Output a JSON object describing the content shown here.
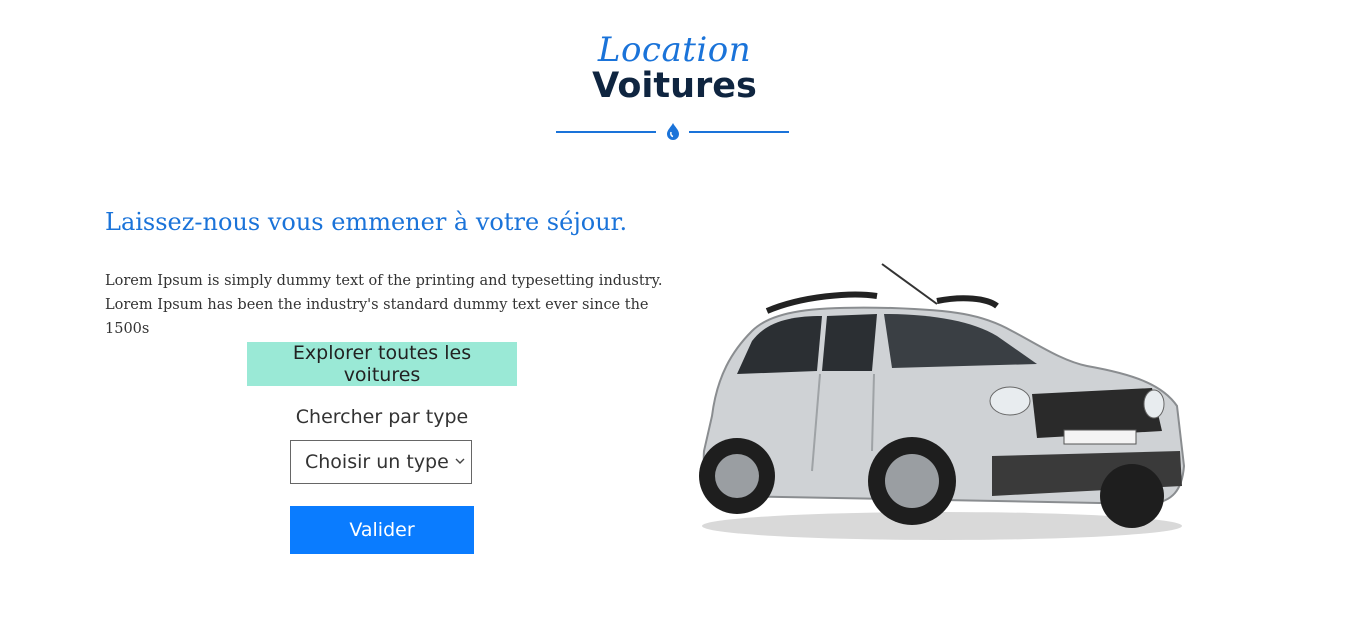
{
  "header": {
    "script_title": "Location",
    "title": "Voitures"
  },
  "intro": {
    "headline": "Laissez-nous vous emmener à votre séjour.",
    "body": "Lorem Ipsum is simply dummy text of the printing and typesetting industry. Lorem Ipsum has been the industry's standard dummy text ever since the 1500s",
    "explore_label": "Explorer toutes les voitures"
  },
  "search": {
    "label": "Chercher par type",
    "selected": "Choisir un type",
    "submit_label": "Valider"
  },
  "colors": {
    "accent_blue": "#1a73d9",
    "title_navy": "#0f2540",
    "mint_button": "#9ae9d6",
    "primary_button": "#0a7cff"
  },
  "icons": {
    "divider": "water-drop-icon",
    "select": "chevron-down-icon"
  }
}
